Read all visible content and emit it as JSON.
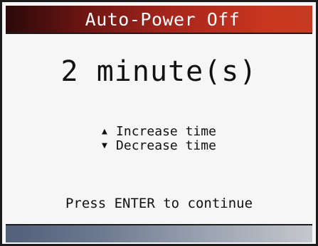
{
  "header": {
    "title": "Auto-Power Off"
  },
  "setting": {
    "value_text": "2 minute(s)"
  },
  "hints": {
    "increase_icon": "triangle-up-icon",
    "increase_arrow": "▲",
    "increase_label": "Increase time",
    "decrease_icon": "triangle-down-icon",
    "decrease_arrow": "▼",
    "decrease_label": "Decrease time"
  },
  "footer": {
    "instruction": "Press ENTER to continue"
  },
  "colors": {
    "title_bar_start": "#2a0a0a",
    "title_bar_end": "#c73a22",
    "title_text": "#ffffff",
    "background": "#f6f6f6",
    "text": "#111111",
    "bottom_bar_start": "#525f78",
    "bottom_bar_end": "#c5c8cd"
  }
}
